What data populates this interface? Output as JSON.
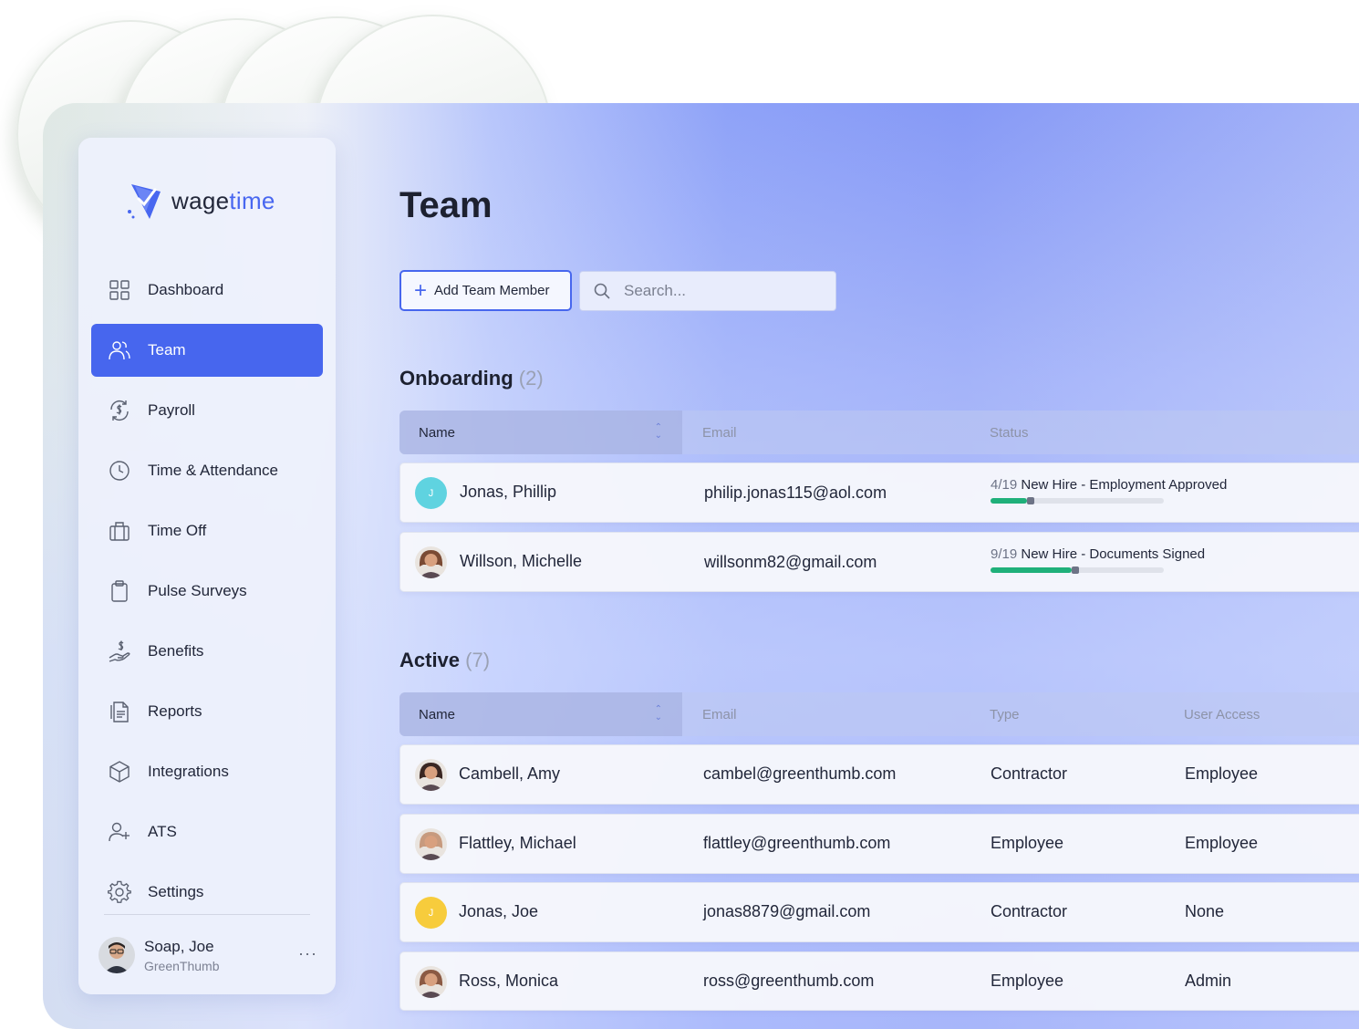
{
  "brand": {
    "name_prefix": "wage",
    "name_suffix": "time",
    "accent": "#4867f0"
  },
  "sidebar": {
    "items": [
      {
        "label": "Dashboard",
        "icon": "grid-icon",
        "active": false
      },
      {
        "label": "Team",
        "icon": "users-icon",
        "active": true
      },
      {
        "label": "Payroll",
        "icon": "dollar-cycle-icon",
        "active": false
      },
      {
        "label": "Time & Attendance",
        "icon": "clock-icon",
        "active": false
      },
      {
        "label": "Time Off",
        "icon": "luggage-icon",
        "active": false
      },
      {
        "label": "Pulse Surveys",
        "icon": "clipboard-icon",
        "active": false
      },
      {
        "label": "Benefits",
        "icon": "hand-dollar-icon",
        "active": false
      },
      {
        "label": "Reports",
        "icon": "document-icon",
        "active": false
      },
      {
        "label": "Integrations",
        "icon": "cube-icon",
        "active": false
      },
      {
        "label": "ATS",
        "icon": "user-plus-icon",
        "active": false
      },
      {
        "label": "Settings",
        "icon": "gear-icon",
        "active": false
      }
    ],
    "user": {
      "name": "Soap, Joe",
      "org": "GreenThumb",
      "more": "···"
    }
  },
  "main": {
    "title": "Team",
    "add_button": "Add Team Member",
    "search_placeholder": "Search...",
    "onboarding": {
      "title": "Onboarding",
      "count": "(2)",
      "columns": [
        "Name",
        "Email",
        "Status"
      ],
      "rows": [
        {
          "name": "Jonas, Phillip",
          "email": "philip.jonas115@aol.com",
          "status_fraction": "4/19",
          "status_label": "New Hire - Employment Approved",
          "progress": 0.21,
          "avatar": "initial",
          "initial": "J",
          "avatar_color": "#5fd3e0"
        },
        {
          "name": "Willson, Michelle",
          "email": "willsonm82@gmail.com",
          "status_fraction": "9/19",
          "status_label": "New Hire - Documents Signed",
          "progress": 0.47,
          "avatar": "photo",
          "initial": "",
          "avatar_color": "#7a4a34"
        }
      ]
    },
    "active": {
      "title": "Active",
      "count": "(7)",
      "columns": [
        "Name",
        "Email",
        "Type",
        "User Access"
      ],
      "rows": [
        {
          "name": "Cambell, Amy",
          "email": "cambel@greenthumb.com",
          "type": "Contractor",
          "access": "Employee",
          "avatar": "photo",
          "initial": "",
          "avatar_color": "#3a2622"
        },
        {
          "name": "Flattley, Michael",
          "email": "flattley@greenthumb.com",
          "type": "Employee",
          "access": "Employee",
          "avatar": "photo",
          "initial": "",
          "avatar_color": "#c79a7e"
        },
        {
          "name": "Jonas, Joe",
          "email": "jonas8879@gmail.com",
          "type": "Contractor",
          "access": "None",
          "avatar": "initial",
          "initial": "J",
          "avatar_color": "#f7cc3c"
        },
        {
          "name": "Ross, Monica",
          "email": "ross@greenthumb.com",
          "type": "Employee",
          "access": "Admin",
          "avatar": "photo",
          "initial": "",
          "avatar_color": "#8b5a44"
        }
      ]
    }
  }
}
